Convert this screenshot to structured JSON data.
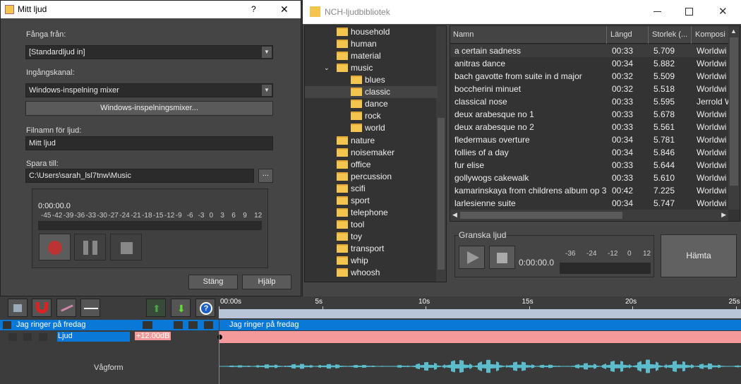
{
  "dialog": {
    "title": "Mitt ljud",
    "help_glyph": "?",
    "close_glyph": "✕",
    "capture_label": "Fånga från:",
    "capture_value": "[Standardljud in]",
    "channel_label": "Ingångskanal:",
    "channel_value": "Windows-inspelning mixer",
    "mixer_button": "Windows-inspelningsmixer...",
    "filename_label": "Filnamn för ljud:",
    "filename_value": "Mitt ljud",
    "saveto_label": "Spara till:",
    "saveto_value": "C:\\Users\\sarah_lsl7tnw\\Music",
    "browse_button": "...",
    "time": "0:00:00.0",
    "meter_ticks": [
      "-45",
      "-42",
      "-39",
      "-36",
      "-33",
      "-30",
      "-27",
      "-24",
      "-21",
      "-18",
      "-15",
      "-12",
      "-9",
      "-6",
      "-3",
      "0",
      "3",
      "6",
      "9",
      "12"
    ],
    "close_button": "Stäng",
    "help_button": "Hjälp"
  },
  "library": {
    "title": "NCH-ljudbibliotek",
    "tree": [
      {
        "label": "household",
        "level": 0
      },
      {
        "label": "human",
        "level": 0
      },
      {
        "label": "material",
        "level": 0
      },
      {
        "label": "music",
        "level": 0,
        "expanded": true
      },
      {
        "label": "blues",
        "level": 1
      },
      {
        "label": "classic",
        "level": 1,
        "selected": true
      },
      {
        "label": "dance",
        "level": 1
      },
      {
        "label": "rock",
        "level": 1
      },
      {
        "label": "world",
        "level": 1
      },
      {
        "label": "nature",
        "level": 0
      },
      {
        "label": "noisemaker",
        "level": 0
      },
      {
        "label": "office",
        "level": 0
      },
      {
        "label": "percussion",
        "level": 0
      },
      {
        "label": "scifi",
        "level": 0
      },
      {
        "label": "sport",
        "level": 0
      },
      {
        "label": "telephone",
        "level": 0
      },
      {
        "label": "tool",
        "level": 0
      },
      {
        "label": "toy",
        "level": 0
      },
      {
        "label": "transport",
        "level": 0
      },
      {
        "label": "whip",
        "level": 0
      },
      {
        "label": "whoosh",
        "level": 0
      }
    ],
    "columns": [
      "Namn",
      "Längd",
      "Storlek (...",
      "Komposi"
    ],
    "rows": [
      [
        "a certain sadness",
        "00:33",
        "5.709",
        "Worldwi"
      ],
      [
        "anitras dance",
        "00:34",
        "5.882",
        "Worldwi"
      ],
      [
        "bach gavotte from suite in d major",
        "00:32",
        "5.509",
        "Worldwi"
      ],
      [
        "boccherini minuet",
        "00:32",
        "5.518",
        "Worldwi"
      ],
      [
        "classical nose",
        "00:33",
        "5.595",
        "Jerrold W"
      ],
      [
        "deux arabesque no 1",
        "00:33",
        "5.678",
        "Worldwi"
      ],
      [
        "deux arabesque no 2",
        "00:33",
        "5.561",
        "Worldwi"
      ],
      [
        "fledermaus overture",
        "00:34",
        "5.781",
        "Worldwi"
      ],
      [
        "follies of a day",
        "00:34",
        "5.846",
        "Worldwi"
      ],
      [
        "fur elise",
        "00:33",
        "5.644",
        "Worldwi"
      ],
      [
        "gollywogs cakewalk",
        "00:33",
        "5.610",
        "Worldwi"
      ],
      [
        "kamarinskaya from childrens album op 39",
        "00:42",
        "7.225",
        "Worldwi"
      ],
      [
        "larlesienne suite",
        "00:34",
        "5.747",
        "Worldwi"
      ]
    ],
    "preview_label": "Granska ljud",
    "preview_time": "0:00:00.0",
    "preview_ticks": [
      "-36",
      "-24",
      "-12",
      "0",
      "12"
    ],
    "download_button": "Hämta"
  },
  "timeline": {
    "ruler": [
      "00:00s",
      "5s",
      "10s",
      "15s",
      "20s",
      "25s"
    ],
    "track_name": "Jag ringer på fredag",
    "clip_name": "Jag ringer på fredag",
    "lane_name": "Ljud",
    "lane_value": "+12.00dB",
    "waveform_label": "Vågform",
    "colors": {
      "track": "#0a78d7",
      "volume_lane": "#f49a9a",
      "waveform": "#5bbccc"
    }
  }
}
